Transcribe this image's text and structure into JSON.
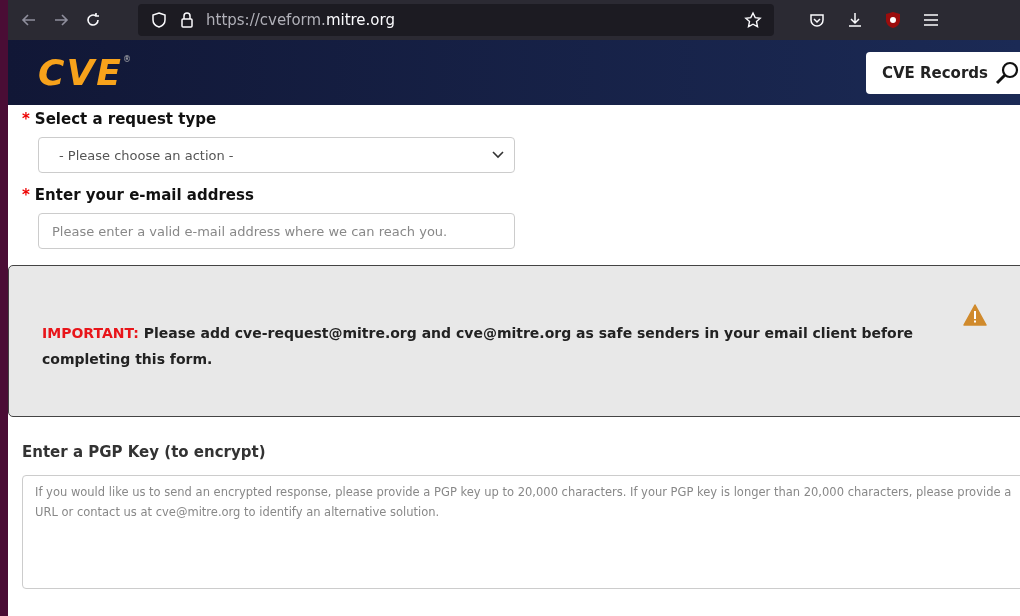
{
  "browser": {
    "url_prefix": "https://cveform.",
    "url_domain": "mitre.org"
  },
  "header": {
    "logo": "CVE",
    "logo_mark": "®",
    "records_button": "CVE Records"
  },
  "fields": [
    {
      "kind": "select",
      "marker": "*",
      "label": "Select a request type",
      "value": "- Please choose an action -"
    },
    {
      "kind": "input",
      "marker": "*",
      "label": "Enter your e-mail address",
      "placeholder": "Please enter a valid e-mail address where we can reach you."
    }
  ],
  "notice": {
    "prefix": "IMPORTANT:",
    "message": "Please add cve-request@mitre.org and cve@mitre.org as safe senders in your email client before completing this form."
  },
  "pgp": {
    "label": "Enter a PGP Key (to encrypt)",
    "placeholder": "If you would like us to send an encrypted response, please provide a PGP key up to 20,000 characters. If your PGP key is longer than 20,000 characters, please provide a URL or contact us at cve@mitre.org to identify an alternative solution."
  }
}
